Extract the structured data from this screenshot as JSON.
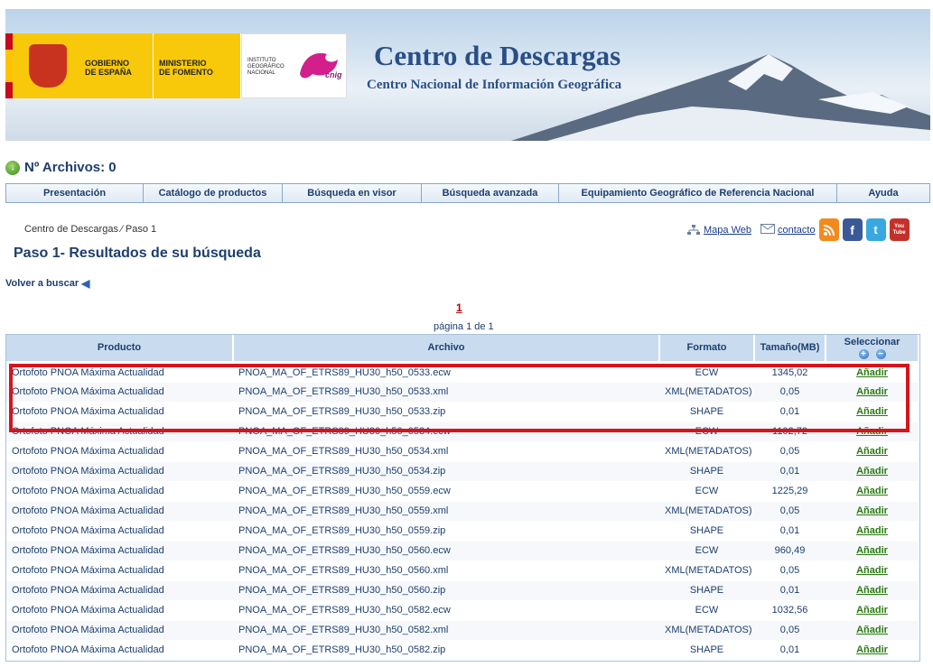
{
  "banner": {
    "title": "Centro de Descargas",
    "subtitle": "Centro Nacional de Información Geográfica",
    "logo_gobierno": "GOBIERNO\nDE ESPAÑA",
    "logo_ministerio": "MINISTERIO\nDE FOMENTO",
    "logo_ign": "INSTITUTO\nGEOGRÁFICO\nNACIONAL",
    "logo_cnig": "cnig"
  },
  "files_count": "Nº Archivos: 0",
  "nav": {
    "items": [
      {
        "label": "Presentación"
      },
      {
        "label": "Catálogo de productos"
      },
      {
        "label": "Búsqueda en visor"
      },
      {
        "label": "Búsqueda avanzada"
      },
      {
        "label": "Equipamiento Geográfico de Referencia Nacional"
      },
      {
        "label": "Ayuda"
      }
    ]
  },
  "breadcrumb": "Centro de Descargas ⁄ Paso 1",
  "social": {
    "mapa_web": "Mapa Web",
    "contacto": "contacto",
    "youtube_label": "You Tube"
  },
  "page_title": "Paso 1- Resultados de su búsqueda",
  "back_link": "Volver a buscar",
  "pager": {
    "current": "1",
    "text": "página 1 de 1"
  },
  "table": {
    "headers": {
      "producto": "Producto",
      "archivo": "Archivo",
      "formato": "Formato",
      "tamano": "Tamaño(MB)",
      "seleccionar": "Seleccionar"
    },
    "add_label": "Añadir",
    "rows": [
      {
        "producto": "Ortofoto PNOA Máxima Actualidad",
        "archivo": "PNOA_MA_OF_ETRS89_HU30_h50_0533.ecw",
        "formato": "ECW",
        "tamano": "1345,02"
      },
      {
        "producto": "Ortofoto PNOA Máxima Actualidad",
        "archivo": "PNOA_MA_OF_ETRS89_HU30_h50_0533.xml",
        "formato": "XML(METADATOS)",
        "tamano": "0,05"
      },
      {
        "producto": "Ortofoto PNOA Máxima Actualidad",
        "archivo": "PNOA_MA_OF_ETRS89_HU30_h50_0533.zip",
        "formato": "SHAPE",
        "tamano": "0,01"
      },
      {
        "producto": "Ortofoto PNOA Máxima Actualidad",
        "archivo": "PNOA_MA_OF_ETRS89_HU30_h50_0534.ecw",
        "formato": "ECW",
        "tamano": "1102,72"
      },
      {
        "producto": "Ortofoto PNOA Máxima Actualidad",
        "archivo": "PNOA_MA_OF_ETRS89_HU30_h50_0534.xml",
        "formato": "XML(METADATOS)",
        "tamano": "0,05"
      },
      {
        "producto": "Ortofoto PNOA Máxima Actualidad",
        "archivo": "PNOA_MA_OF_ETRS89_HU30_h50_0534.zip",
        "formato": "SHAPE",
        "tamano": "0,01"
      },
      {
        "producto": "Ortofoto PNOA Máxima Actualidad",
        "archivo": "PNOA_MA_OF_ETRS89_HU30_h50_0559.ecw",
        "formato": "ECW",
        "tamano": "1225,29"
      },
      {
        "producto": "Ortofoto PNOA Máxima Actualidad",
        "archivo": "PNOA_MA_OF_ETRS89_HU30_h50_0559.xml",
        "formato": "XML(METADATOS)",
        "tamano": "0,05"
      },
      {
        "producto": "Ortofoto PNOA Máxima Actualidad",
        "archivo": "PNOA_MA_OF_ETRS89_HU30_h50_0559.zip",
        "formato": "SHAPE",
        "tamano": "0,01"
      },
      {
        "producto": "Ortofoto PNOA Máxima Actualidad",
        "archivo": "PNOA_MA_OF_ETRS89_HU30_h50_0560.ecw",
        "formato": "ECW",
        "tamano": "960,49"
      },
      {
        "producto": "Ortofoto PNOA Máxima Actualidad",
        "archivo": "PNOA_MA_OF_ETRS89_HU30_h50_0560.xml",
        "formato": "XML(METADATOS)",
        "tamano": "0,05"
      },
      {
        "producto": "Ortofoto PNOA Máxima Actualidad",
        "archivo": "PNOA_MA_OF_ETRS89_HU30_h50_0560.zip",
        "formato": "SHAPE",
        "tamano": "0,01"
      },
      {
        "producto": "Ortofoto PNOA Máxima Actualidad",
        "archivo": "PNOA_MA_OF_ETRS89_HU30_h50_0582.ecw",
        "formato": "ECW",
        "tamano": "1032,56"
      },
      {
        "producto": "Ortofoto PNOA Máxima Actualidad",
        "archivo": "PNOA_MA_OF_ETRS89_HU30_h50_0582.xml",
        "formato": "XML(METADATOS)",
        "tamano": "0,05"
      },
      {
        "producto": "Ortofoto PNOA Máxima Actualidad",
        "archivo": "PNOA_MA_OF_ETRS89_HU30_h50_0582.zip",
        "formato": "SHAPE",
        "tamano": "0,01"
      }
    ]
  },
  "colors": {
    "accent_blue": "#1d3e6e",
    "header_bg": "#c9dcef",
    "link_green": "#2a7a12",
    "highlight_red": "#d7141b",
    "flag_yellow": "#f8c90b"
  },
  "icons": {
    "files": "download-icon",
    "sitemap": "sitemap-icon",
    "mail": "mail-icon",
    "rss": "rss-icon",
    "facebook": "facebook-icon",
    "twitter": "twitter-icon",
    "youtube": "youtube-icon",
    "back": "back-arrow-icon",
    "select_all": "plus-circle-icon",
    "deselect_all": "minus-circle-icon"
  }
}
